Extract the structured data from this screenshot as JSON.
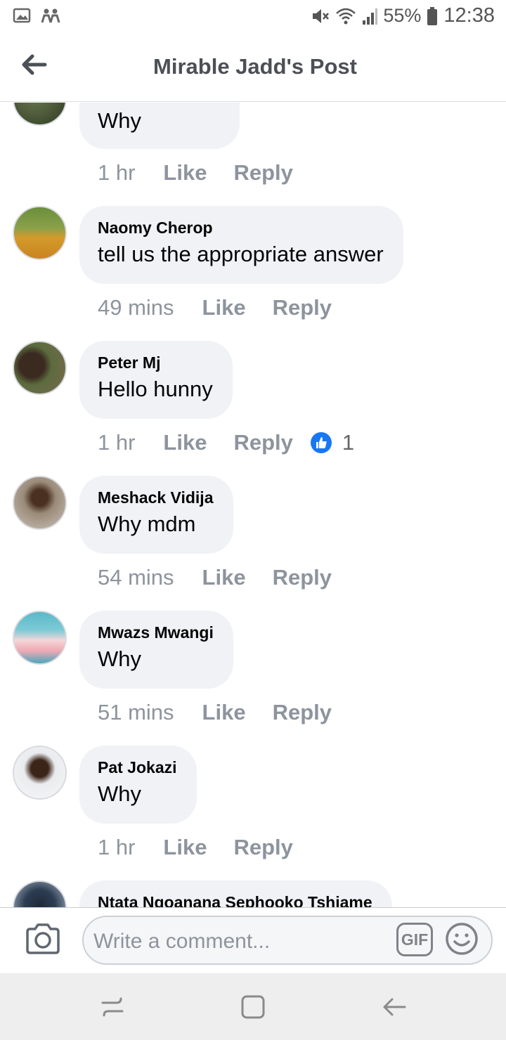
{
  "status_bar": {
    "battery": "55%",
    "time": "12:38"
  },
  "header": {
    "title": "Mirable Jadd's Post"
  },
  "comments": [
    {
      "author": "",
      "text": "Why",
      "time": "1 hr",
      "like": "Like",
      "reply": "Reply"
    },
    {
      "author": "Naomy Cherop",
      "text": "tell us the appropriate answer",
      "time": "49 mins",
      "like": "Like",
      "reply": "Reply"
    },
    {
      "author": "Peter Mj",
      "text": "Hello hunny",
      "time": "1 hr",
      "like": "Like",
      "reply": "Reply",
      "reaction_count": "1"
    },
    {
      "author": "Meshack Vidija",
      "text": "Why mdm",
      "time": "54 mins",
      "like": "Like",
      "reply": "Reply"
    },
    {
      "author": "Mwazs Mwangi",
      "text": "Why",
      "time": "51 mins",
      "like": "Like",
      "reply": "Reply"
    },
    {
      "author": "Pat Jokazi",
      "text": "Why",
      "time": "1 hr",
      "like": "Like",
      "reply": "Reply"
    },
    {
      "author": "Ntata Ngoanana Sephooko Tshiame",
      "text": ""
    }
  ],
  "composer": {
    "placeholder": "Write a comment...",
    "gif_label": "GIF"
  },
  "colors": {
    "like_blue": "#1877f2",
    "bubble": "#f0f2f5",
    "meta": "#8d949e"
  }
}
